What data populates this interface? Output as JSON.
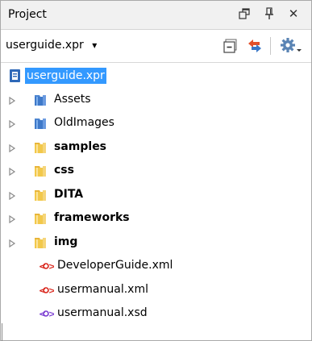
{
  "panel": {
    "title": "Project",
    "restore_icon": "restore-window-icon",
    "pin_icon": "pin-icon",
    "close_glyph": "✕"
  },
  "toolbar": {
    "project_name": "userguide.xpr",
    "dropdown_glyph": "▾"
  },
  "tree": {
    "root": {
      "label": "userguide.xpr",
      "icon": "project-file-icon",
      "selected": true
    },
    "items": [
      {
        "label": "Assets",
        "icon": "linked-folder-icon",
        "bold": false,
        "expandable": true
      },
      {
        "label": "OldImages",
        "icon": "linked-folder-icon",
        "bold": false,
        "expandable": true
      },
      {
        "label": "samples",
        "icon": "folder-icon",
        "bold": true,
        "expandable": true
      },
      {
        "label": "css",
        "icon": "folder-icon",
        "bold": true,
        "expandable": true
      },
      {
        "label": "DITA",
        "icon": "folder-icon",
        "bold": true,
        "expandable": true
      },
      {
        "label": "frameworks",
        "icon": "folder-icon",
        "bold": true,
        "expandable": true
      },
      {
        "label": "img",
        "icon": "folder-icon",
        "bold": true,
        "expandable": true
      },
      {
        "label": "DeveloperGuide.xml",
        "icon": "xml-file-icon",
        "bold": false,
        "expandable": false
      },
      {
        "label": "usermanual.xml",
        "icon": "xml-file-icon",
        "bold": false,
        "expandable": false
      },
      {
        "label": "usermanual.xsd",
        "icon": "xsd-file-icon",
        "bold": false,
        "expandable": false
      }
    ]
  },
  "colors": {
    "selection": "#3399ff",
    "folder": "#f2c84b",
    "linked_folder": "#3f79c9",
    "xml_red": "#d9261c",
    "xsd_purple": "#7a3bd1"
  }
}
